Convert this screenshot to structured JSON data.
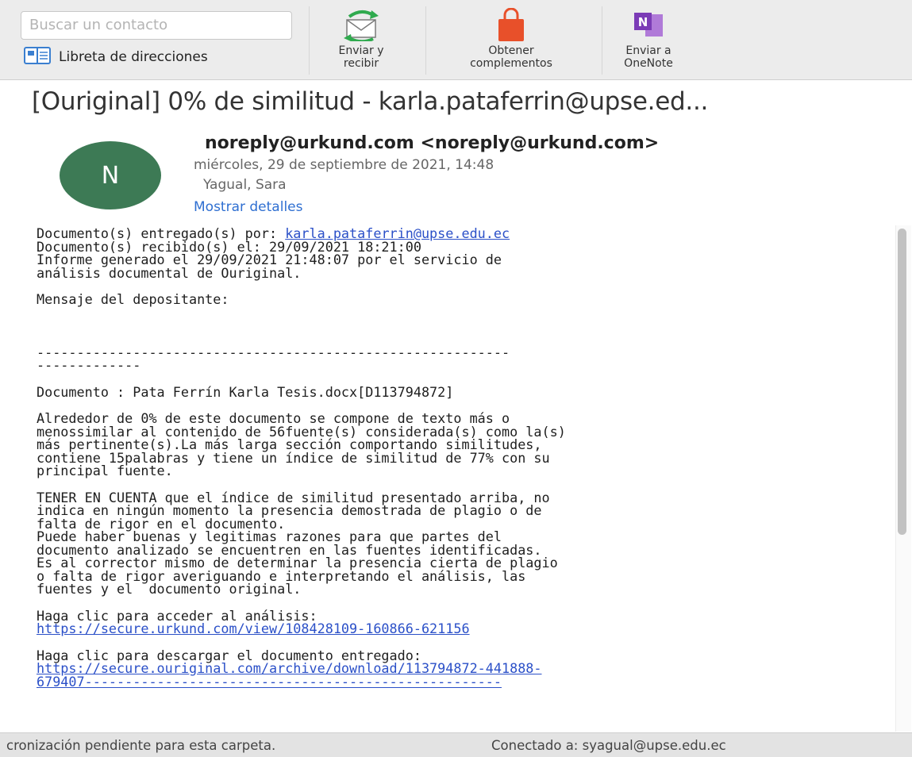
{
  "toolbar": {
    "search_placeholder": "Buscar un contacto",
    "address_book_label": "Libreta de direcciones",
    "buttons": [
      {
        "line1": "Enviar y",
        "line2": "recibir",
        "icon": "send-receive-icon"
      },
      {
        "line1": "Obtener",
        "line2": "complementos",
        "icon": "store-bag-icon"
      },
      {
        "line1": "Enviar a",
        "line2": "OneNote",
        "icon": "onenote-icon"
      }
    ]
  },
  "message": {
    "subject": "[Ouriginal] 0% de similitud - karla.pataferrin@upse.ed...",
    "avatar_letter": "N",
    "from": "noreply@urkund.com <noreply@urkund.com>",
    "date": "miércoles, 29 de septiembre de 2021, 14:48",
    "to": "Yagual, Sara",
    "show_details": "Mostrar detalles",
    "body": {
      "delivered_by_label": "Documento(s) entregado(s) por: ",
      "delivered_by_email": "karla.pataferrin@upse.edu.ec",
      "received": "Documento(s) recibido(s) el: 29/09/2021 18:21:00",
      "report_l1": "Informe generado el 29/09/2021 21:48:07 por el servicio de",
      "report_l2": "análisis documental de Ouriginal.",
      "depositor_msg": "Mensaje del depositante:",
      "separator_l1": "-----------------------------------------------------------",
      "separator_l2": "-------------",
      "document": "Documento : Pata Ferrín Karla Tesis.docx[D113794872]",
      "para1": [
        "Alrededor de 0% de este documento se compone de texto más o",
        "menossimilar al contenido de 56fuente(s) considerada(s) como la(s)",
        "más pertinente(s).La más larga sección comportando similitudes,",
        "contiene 15palabras y tiene un índice de similitud de 77% con su",
        "principal fuente."
      ],
      "para2": [
        "TENER EN CUENTA que el índice de similitud presentado arriba, no",
        "indica en ningún momento la presencia demostrada de plagio o de",
        "falta de rigor en el documento.",
        "Puede haber buenas y legitimas razones para que partes del",
        "documento analizado se encuentren en las fuentes identificadas.",
        "Es al corrector mismo de determinar la presencia cierta de plagio",
        "o falta de rigor averiguando e interpretando el análisis, las",
        "fuentes y el  documento original."
      ],
      "analysis_label": "Haga clic para acceder al análisis:",
      "analysis_url": "https://secure.urkund.com/view/108428109-160866-621156",
      "download_label": "Haga clic para descargar el documento entregado:",
      "download_url_l1": "https://secure.ouriginal.com/archive/download/113794872-441888-",
      "download_url_l2": "679407----------------------------------------------------"
    }
  },
  "status": {
    "sync": "cronización pendiente para esta carpeta.",
    "connected": "Conectado a: syagual@upse.edu.ec"
  },
  "colors": {
    "avatar": "#3d7a55",
    "link": "#2b50c8",
    "details_link": "#2f6fd1",
    "store_icon": "#e8502a",
    "onenote_icon": "#7b3bb6",
    "send_receive_icon": "#2faa4e"
  }
}
